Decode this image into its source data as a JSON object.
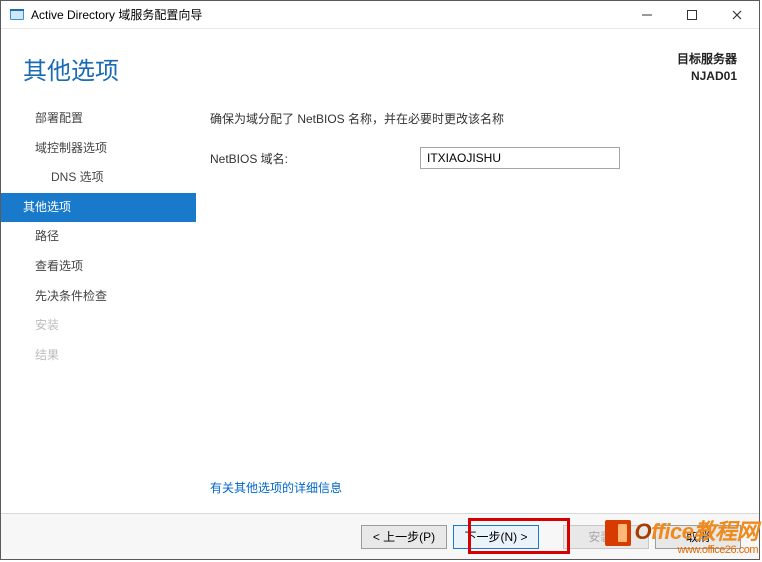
{
  "window": {
    "title": "Active Directory 域服务配置向导"
  },
  "header": {
    "page_title": "其他选项",
    "target_label": "目标服务器",
    "target_name": "NJAD01"
  },
  "sidebar": {
    "items": [
      {
        "label": "部署配置",
        "state": "normal"
      },
      {
        "label": "域控制器选项",
        "state": "normal"
      },
      {
        "label": "DNS 选项",
        "state": "normal-level2"
      },
      {
        "label": "其他选项",
        "state": "active"
      },
      {
        "label": "路径",
        "state": "normal"
      },
      {
        "label": "查看选项",
        "state": "normal"
      },
      {
        "label": "先决条件检查",
        "state": "normal"
      },
      {
        "label": "安装",
        "state": "disabled"
      },
      {
        "label": "结果",
        "state": "disabled"
      }
    ]
  },
  "main": {
    "instruction": "确保为域分配了 NetBIOS 名称，并在必要时更改该名称",
    "netbios_label": "NetBIOS 域名:",
    "netbios_value": "ITXIAOJISHU",
    "more_link": "有关其他选项的详细信息"
  },
  "footer": {
    "prev": "< 上一步(P)",
    "next": "下一步(N) >",
    "install": "安装(I)",
    "cancel": "取消"
  },
  "watermark": {
    "text_part1": "O",
    "text_part2": "ffice教程网",
    "url": "www.office26.com"
  }
}
